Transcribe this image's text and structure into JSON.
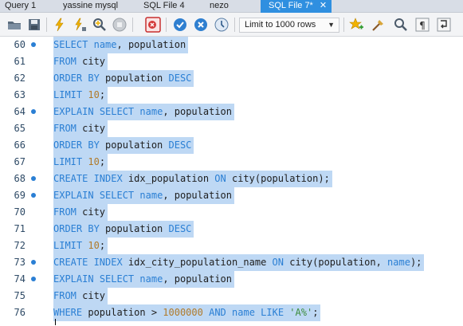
{
  "tabs": [
    {
      "label": "Query 1"
    },
    {
      "label": "yassine mysql"
    },
    {
      "label": "SQL File 4"
    },
    {
      "label": "nezo"
    },
    {
      "label": "SQL File 7*",
      "active": true
    }
  ],
  "toolbar": {
    "icons": [
      "open-folder-icon",
      "save-icon",
      "execute-icon",
      "execute-current-icon",
      "explain-icon",
      "stop-icon",
      "toggle-error-icon",
      "commit-icon",
      "rollback-icon",
      "autocommit-icon",
      "add-snippet-icon",
      "beautify-icon",
      "find-icon",
      "invisible-chars-icon",
      "wrap-icon"
    ],
    "limit_select": "Limit to 1000 rows"
  },
  "editor": {
    "lines": [
      {
        "n": "60",
        "dot": true,
        "tokens": [
          [
            "kw",
            "SELECT"
          ],
          [
            "t",
            " "
          ],
          [
            "kw",
            "name"
          ],
          [
            "t",
            ", population"
          ]
        ]
      },
      {
        "n": "61",
        "dot": false,
        "tokens": [
          [
            "kw",
            "FROM"
          ],
          [
            "t",
            " city"
          ]
        ]
      },
      {
        "n": "62",
        "dot": false,
        "tokens": [
          [
            "kw",
            "ORDER BY"
          ],
          [
            "t",
            " population "
          ],
          [
            "kw",
            "DESC"
          ]
        ]
      },
      {
        "n": "63",
        "dot": false,
        "tokens": [
          [
            "kw",
            "LIMIT"
          ],
          [
            "t",
            " "
          ],
          [
            "num",
            "10"
          ],
          [
            "t",
            ";"
          ]
        ]
      },
      {
        "n": "64",
        "dot": true,
        "tokens": [
          [
            "kw",
            "EXPLAIN"
          ],
          [
            "t",
            " "
          ],
          [
            "kw",
            "SELECT"
          ],
          [
            "t",
            " "
          ],
          [
            "kw",
            "name"
          ],
          [
            "t",
            ", population"
          ]
        ]
      },
      {
        "n": "65",
        "dot": false,
        "tokens": [
          [
            "kw",
            "FROM"
          ],
          [
            "t",
            " city"
          ]
        ]
      },
      {
        "n": "66",
        "dot": false,
        "tokens": [
          [
            "kw",
            "ORDER BY"
          ],
          [
            "t",
            " population "
          ],
          [
            "kw",
            "DESC"
          ]
        ]
      },
      {
        "n": "67",
        "dot": false,
        "tokens": [
          [
            "kw",
            "LIMIT"
          ],
          [
            "t",
            " "
          ],
          [
            "num",
            "10"
          ],
          [
            "t",
            ";"
          ]
        ]
      },
      {
        "n": "68",
        "dot": true,
        "tokens": [
          [
            "kw",
            "CREATE INDEX"
          ],
          [
            "t",
            " idx_population "
          ],
          [
            "kw",
            "ON"
          ],
          [
            "t",
            " city(population);"
          ]
        ]
      },
      {
        "n": "69",
        "dot": true,
        "tokens": [
          [
            "kw",
            "EXPLAIN"
          ],
          [
            "t",
            " "
          ],
          [
            "kw",
            "SELECT"
          ],
          [
            "t",
            " "
          ],
          [
            "kw",
            "name"
          ],
          [
            "t",
            ", population"
          ]
        ]
      },
      {
        "n": "70",
        "dot": false,
        "tokens": [
          [
            "kw",
            "FROM"
          ],
          [
            "t",
            " city"
          ]
        ]
      },
      {
        "n": "71",
        "dot": false,
        "tokens": [
          [
            "kw",
            "ORDER BY"
          ],
          [
            "t",
            " population "
          ],
          [
            "kw",
            "DESC"
          ]
        ]
      },
      {
        "n": "72",
        "dot": false,
        "tokens": [
          [
            "kw",
            "LIMIT"
          ],
          [
            "t",
            " "
          ],
          [
            "num",
            "10"
          ],
          [
            "t",
            ";"
          ]
        ]
      },
      {
        "n": "73",
        "dot": true,
        "tokens": [
          [
            "kw",
            "CREATE INDEX"
          ],
          [
            "t",
            " idx_city_population_name "
          ],
          [
            "kw",
            "ON"
          ],
          [
            "t",
            " city(population, "
          ],
          [
            "kw",
            "name"
          ],
          [
            "t",
            ");"
          ]
        ]
      },
      {
        "n": "74",
        "dot": true,
        "tokens": [
          [
            "kw",
            "EXPLAIN"
          ],
          [
            "t",
            " "
          ],
          [
            "kw",
            "SELECT"
          ],
          [
            "t",
            " "
          ],
          [
            "kw",
            "name"
          ],
          [
            "t",
            ", population"
          ]
        ]
      },
      {
        "n": "75",
        "dot": false,
        "tokens": [
          [
            "kw",
            "FROM"
          ],
          [
            "t",
            " city"
          ]
        ]
      },
      {
        "n": "76",
        "dot": false,
        "tokens": [
          [
            "kw",
            "WHERE"
          ],
          [
            "t",
            " population > "
          ],
          [
            "num",
            "1000000"
          ],
          [
            "t",
            " "
          ],
          [
            "kw",
            "AND"
          ],
          [
            "t",
            " "
          ],
          [
            "kw",
            "name"
          ],
          [
            "t",
            " "
          ],
          [
            "kw",
            "LIKE"
          ],
          [
            "t",
            " "
          ],
          [
            "str",
            "'A%'"
          ],
          [
            "t",
            ";"
          ]
        ]
      }
    ]
  }
}
